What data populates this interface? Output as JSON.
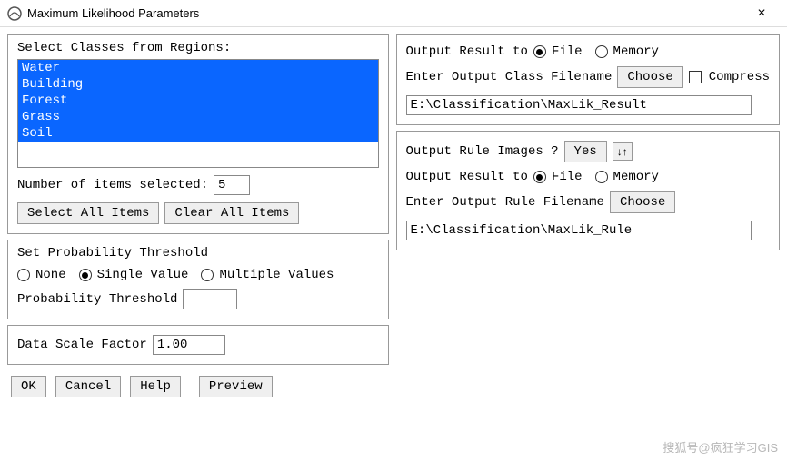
{
  "window": {
    "title": "Maximum Likelihood Parameters",
    "close": "×"
  },
  "left": {
    "select_label": "Select Classes from Regions:",
    "classes": [
      "Water",
      "Building",
      "Forest",
      "Grass",
      "Soil"
    ],
    "num_items_label": "Number of items selected:",
    "num_items_value": "5",
    "select_all": "Select All Items",
    "clear_all": "Clear All Items",
    "threshold_legend": "Set Probability Threshold",
    "thr_none": "None",
    "thr_single": "Single Value",
    "thr_multiple": "Multiple Values",
    "prob_thresh_label": "Probability Threshold",
    "prob_thresh_value": "",
    "scale_label": "Data Scale Factor",
    "scale_value": "1.00"
  },
  "right": {
    "output_to_label": "Output Result to",
    "opt_file": "File",
    "opt_memory": "Memory",
    "class_fname_label": "Enter Output Class Filename",
    "choose": "Choose",
    "compress_label": "Compress",
    "class_path": "E:\\Classification\\MaxLik_Result",
    "rule_images_label": "Output Rule Images ?",
    "rule_images_value": "Yes",
    "rule_fname_label": "Enter Output Rule Filename",
    "rule_path": "E:\\Classification\\MaxLik_Rule"
  },
  "buttons": {
    "ok": "OK",
    "cancel": "Cancel",
    "help": "Help",
    "preview": "Preview"
  },
  "watermark": "搜狐号@疯狂学习GIS"
}
